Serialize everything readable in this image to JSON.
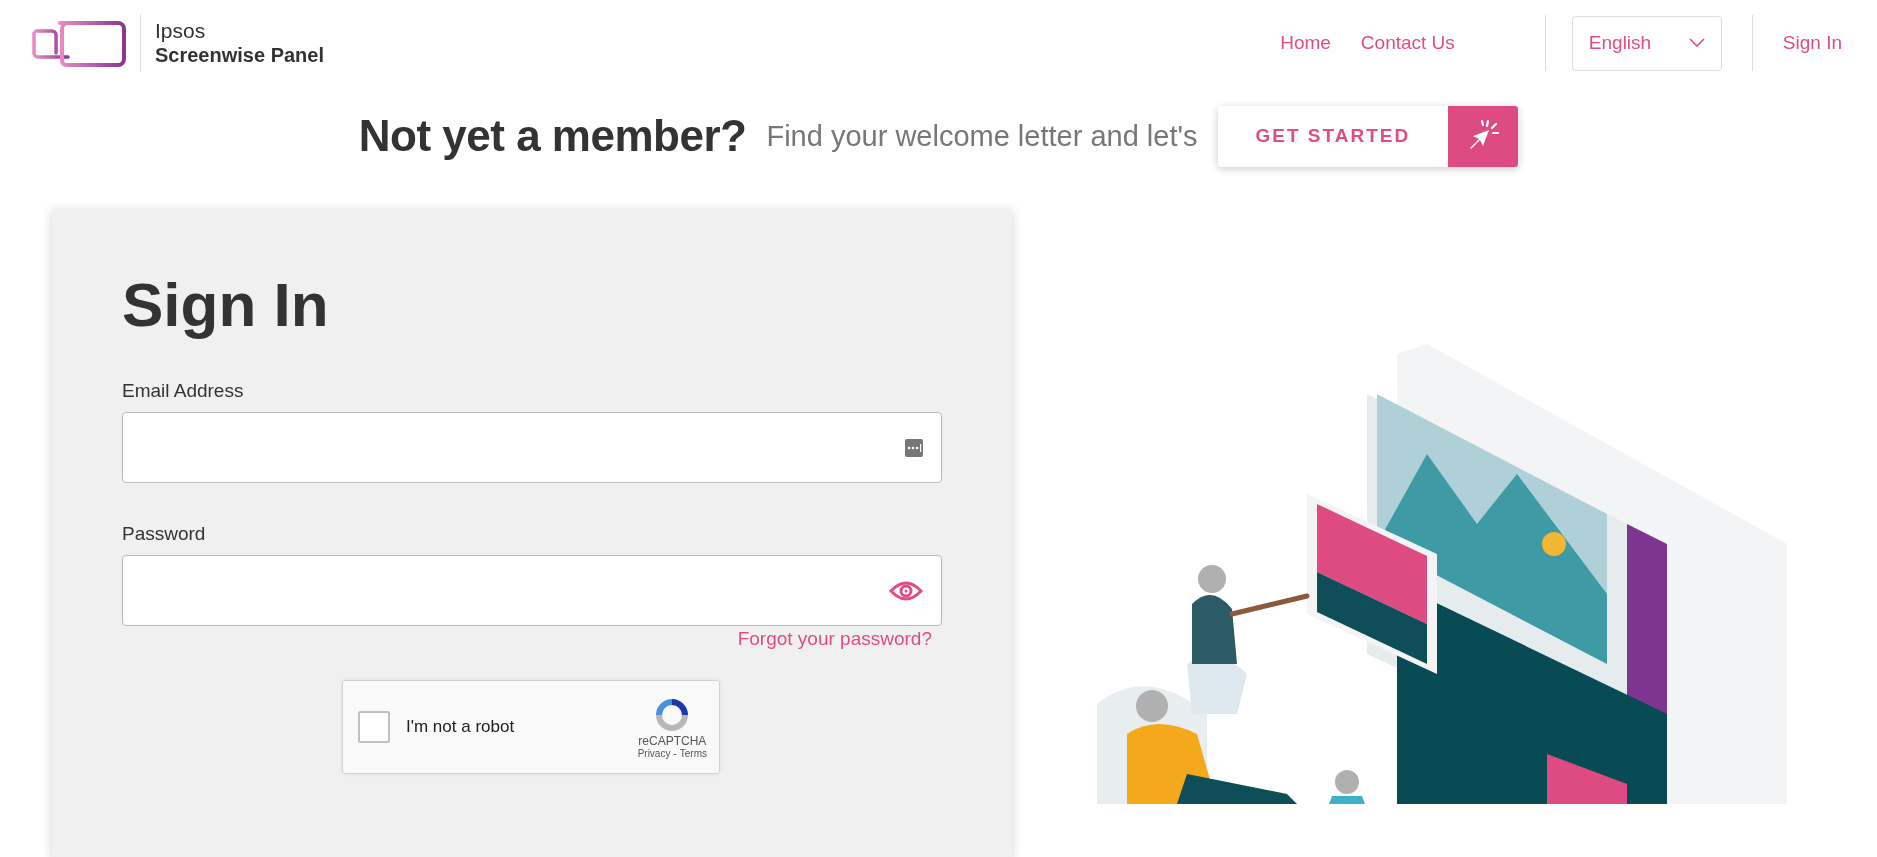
{
  "brand": {
    "line1": "Ipsos",
    "line2": "Screenwise Panel"
  },
  "nav": [
    {
      "label": "Home"
    },
    {
      "label": "Contact Us"
    }
  ],
  "language": {
    "value": "English"
  },
  "nav_sign_in": "Sign In",
  "banner": {
    "heading": "Not yet a member?",
    "text": "Find your welcome letter and let's",
    "button": "GET STARTED"
  },
  "form": {
    "title": "Sign In",
    "fields": [
      {
        "label": "Email Address",
        "kind": "email"
      },
      {
        "label": "Password",
        "kind": "password"
      }
    ],
    "forgot": "Forgot your password?",
    "captcha": {
      "label": "I'm not a robot",
      "checked": false,
      "brand": "reCAPTCHA",
      "privacy": "Privacy",
      "separator": "-",
      "terms": "Terms"
    }
  }
}
